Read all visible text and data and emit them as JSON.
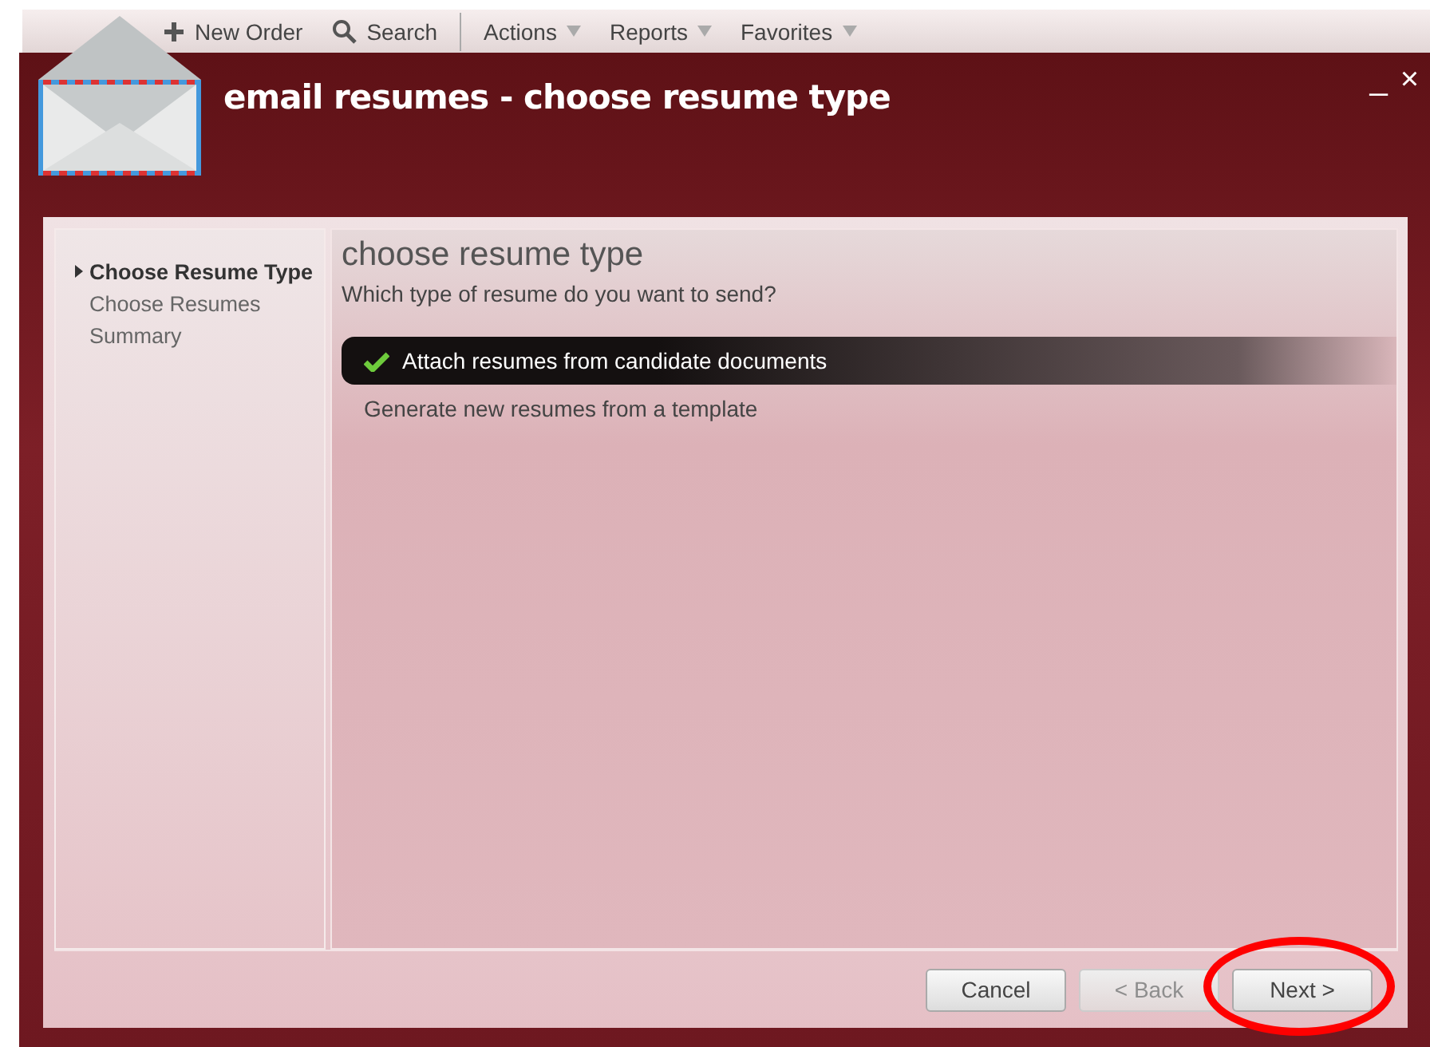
{
  "toolbar": [
    {
      "label": "New Order",
      "kind": "plus"
    },
    {
      "label": "Search",
      "kind": "search"
    },
    {
      "label": "Actions",
      "kind": "menu"
    },
    {
      "label": "Reports",
      "kind": "menu"
    },
    {
      "label": "Favorites",
      "kind": "menu"
    }
  ],
  "window": {
    "title": "email resumes - choose resume type",
    "controls": [
      "_",
      "×"
    ]
  },
  "steps": [
    {
      "label": "Choose Resume Type",
      "selected": true
    },
    {
      "label": "Choose Resumes",
      "selected": false
    },
    {
      "label": "Summary",
      "selected": false
    }
  ],
  "page": {
    "heading": "choose resume type",
    "question": "Which type of resume do you want to send?"
  },
  "options": [
    {
      "label": "Attach resumes from candidate documents",
      "selected": true
    },
    {
      "label": "Generate new resumes from a template",
      "selected": false
    }
  ],
  "buttons": [
    {
      "label": "Cancel",
      "disabled": false,
      "circled": false
    },
    {
      "label": "< Back",
      "disabled": true,
      "circled": false
    },
    {
      "label": "Next >",
      "disabled": false,
      "circled": true
    }
  ]
}
